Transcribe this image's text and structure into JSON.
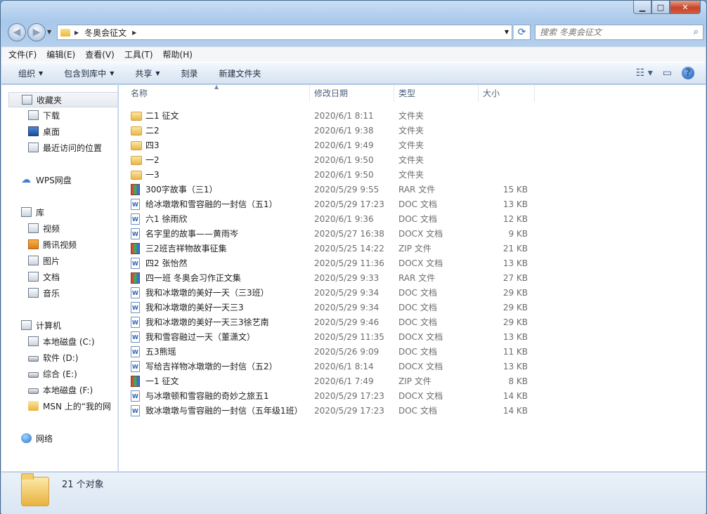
{
  "window": {
    "title_buttons": [
      "minimize",
      "maximize",
      "close"
    ]
  },
  "address_bar": {
    "breadcrumb": [
      "冬奥会征文"
    ]
  },
  "search": {
    "placeholder": "搜索 冬奥会征文"
  },
  "menu": [
    "文件(F)",
    "编辑(E)",
    "查看(V)",
    "工具(T)",
    "帮助(H)"
  ],
  "commands": [
    {
      "label": "组织",
      "has_dropdown": true
    },
    {
      "label": "包含到库中",
      "has_dropdown": true
    },
    {
      "label": "共享",
      "has_dropdown": true
    },
    {
      "label": "刻录",
      "has_dropdown": false
    },
    {
      "label": "新建文件夹",
      "has_dropdown": false
    }
  ],
  "nav": {
    "favorites": "收藏夹",
    "downloads": "下载",
    "desktop": "桌面",
    "recent": "最近访问的位置",
    "wps": "WPS网盘",
    "libraries": "库",
    "videos": "视频",
    "tencent_video": "腾讯视频",
    "pictures": "图片",
    "documents": "文档",
    "music": "音乐",
    "computer": "计算机",
    "drive_c": "本地磁盘 (C:)",
    "drive_d": "软件 (D:)",
    "drive_e": "综合 (E:)",
    "drive_f": "本地磁盘 (F:)",
    "msn": "MSN 上的“我的网",
    "network": "网络"
  },
  "columns": {
    "name": "名称",
    "date": "修改日期",
    "type": "类型",
    "size": "大小"
  },
  "files": [
    {
      "name": "二1 征文",
      "date": "2020/6/1 8:11",
      "type": "文件夹",
      "size": "",
      "icon": "folder"
    },
    {
      "name": "二2",
      "date": "2020/6/1 9:38",
      "type": "文件夹",
      "size": "",
      "icon": "folder"
    },
    {
      "name": "四3",
      "date": "2020/6/1 9:49",
      "type": "文件夹",
      "size": "",
      "icon": "folder"
    },
    {
      "name": "一2",
      "date": "2020/6/1 9:50",
      "type": "文件夹",
      "size": "",
      "icon": "folder"
    },
    {
      "name": "一3",
      "date": "2020/6/1 9:50",
      "type": "文件夹",
      "size": "",
      "icon": "folder"
    },
    {
      "name": "300字故事（三1）",
      "date": "2020/5/29 9:55",
      "type": "RAR 文件",
      "size": "15 KB",
      "icon": "archive"
    },
    {
      "name": "给冰墩墩和雪容融的一封信（五1）",
      "date": "2020/5/29 17:23",
      "type": "DOC 文档",
      "size": "13 KB",
      "icon": "doc"
    },
    {
      "name": "六1  徐雨欣",
      "date": "2020/6/1 9:36",
      "type": "DOC 文档",
      "size": "12 KB",
      "icon": "doc"
    },
    {
      "name": "名字里的故事——黄雨岑",
      "date": "2020/5/27 16:38",
      "type": "DOCX 文档",
      "size": "9 KB",
      "icon": "doc"
    },
    {
      "name": "三2班吉祥物故事征集",
      "date": "2020/5/25 14:22",
      "type": "ZIP 文件",
      "size": "21 KB",
      "icon": "archive"
    },
    {
      "name": "四2 张怡然",
      "date": "2020/5/29 11:36",
      "type": "DOCX 文档",
      "size": "13 KB",
      "icon": "doc"
    },
    {
      "name": "四一班  冬奥会习作正文集",
      "date": "2020/5/29 9:33",
      "type": "RAR 文件",
      "size": "27 KB",
      "icon": "archive"
    },
    {
      "name": "我和冰墩墩的美好一天（三3班）",
      "date": "2020/5/29 9:34",
      "type": "DOC 文档",
      "size": "29 KB",
      "icon": "doc"
    },
    {
      "name": "我和冰墩墩的美好一天三3",
      "date": "2020/5/29 9:34",
      "type": "DOC 文档",
      "size": "29 KB",
      "icon": "doc"
    },
    {
      "name": "我和冰墩墩的美好一天三3徐艺南",
      "date": "2020/5/29 9:46",
      "type": "DOC 文档",
      "size": "29 KB",
      "icon": "doc"
    },
    {
      "name": "我和雪容融过一天（董潇文）",
      "date": "2020/5/29 11:35",
      "type": "DOCX 文档",
      "size": "13 KB",
      "icon": "doc"
    },
    {
      "name": "五3熊瑶",
      "date": "2020/5/26 9:09",
      "type": "DOC 文档",
      "size": "11 KB",
      "icon": "doc"
    },
    {
      "name": "写给吉祥物冰墩墩的一封信（五2）",
      "date": "2020/6/1 8:14",
      "type": "DOCX 文档",
      "size": "13 KB",
      "icon": "doc"
    },
    {
      "name": "一1   征文",
      "date": "2020/6/1 7:49",
      "type": "ZIP 文件",
      "size": "8 KB",
      "icon": "archive"
    },
    {
      "name": "与冰墩顿和雪容融的奇妙之旅五1",
      "date": "2020/5/29 17:23",
      "type": "DOCX 文档",
      "size": "14 KB",
      "icon": "doc"
    },
    {
      "name": "致冰墩墩与雪容融的一封信（五年级1班）",
      "date": "2020/5/29 17:23",
      "type": "DOC 文档",
      "size": "14 KB",
      "icon": "doc"
    }
  ],
  "status": {
    "count_text": "21 个对象"
  }
}
